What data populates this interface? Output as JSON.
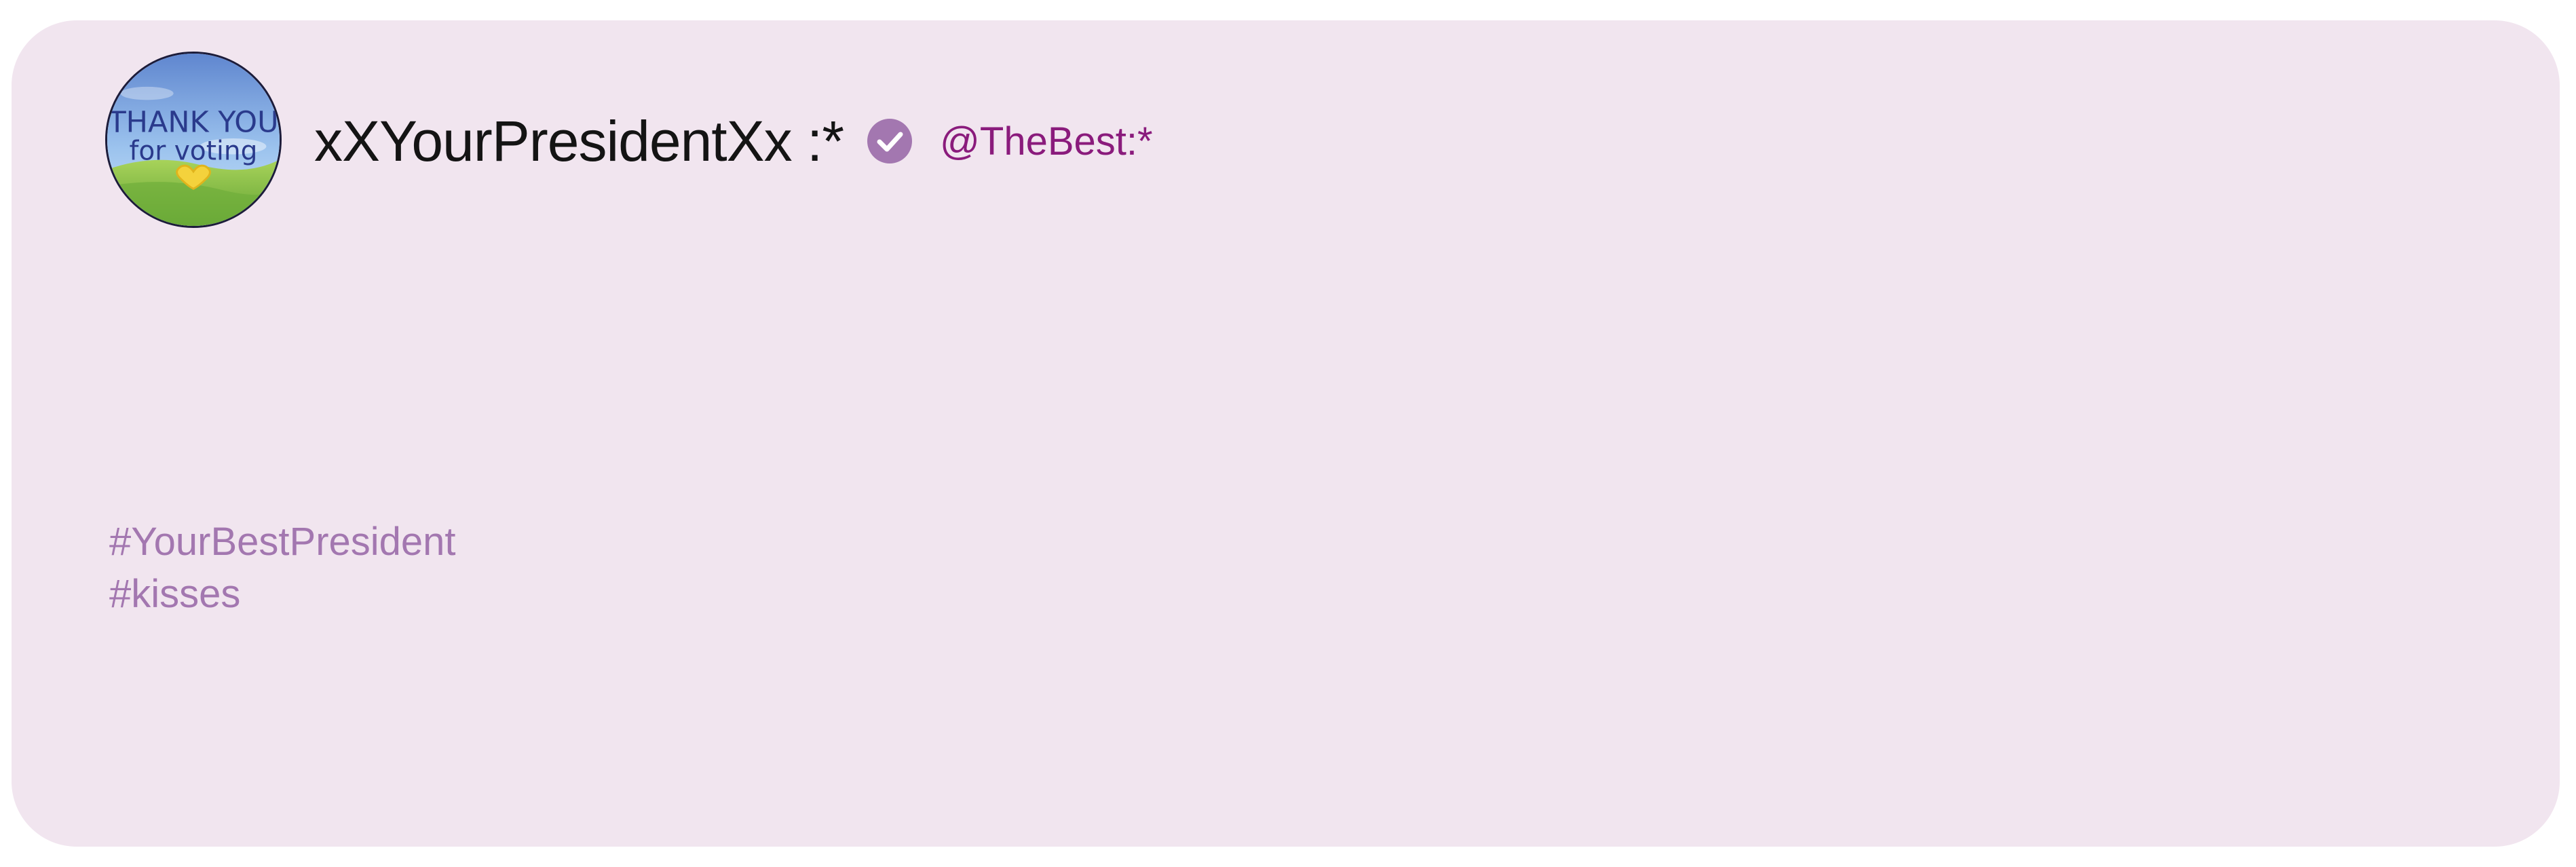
{
  "profile": {
    "display_name": "xXYourPresidentXx :*",
    "handle": "@TheBest:*",
    "verified": true,
    "avatar_icon": "thank-you-for-voting-sticker",
    "avatar_text": "THANK YOU for voting"
  },
  "hashtags": [
    "#YourBestPresident",
    "#kisses"
  ],
  "colors": {
    "card_background": "#f1e5ef",
    "handle": "#8a1b7c",
    "hashtag": "#a377b0",
    "verified_badge": "#a377b0"
  }
}
